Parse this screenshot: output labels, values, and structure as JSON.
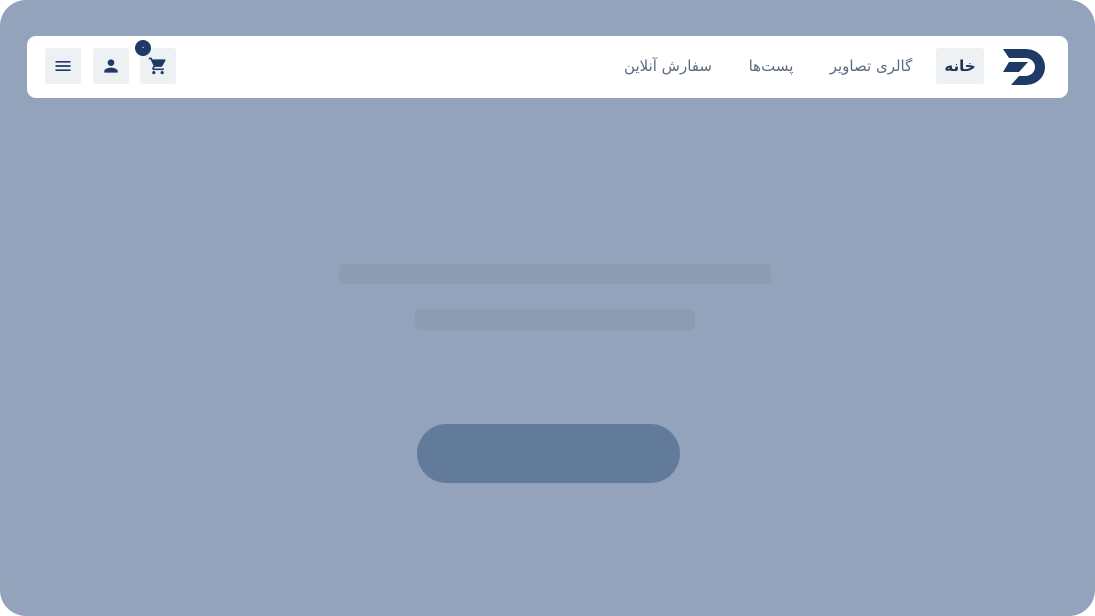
{
  "navbar": {
    "logo_icon": "brand-d-logo-icon",
    "links": [
      {
        "label": "خانه",
        "active": true
      },
      {
        "label": "گالری تصاویر",
        "active": false
      },
      {
        "label": "پست‌ها",
        "active": false
      },
      {
        "label": "سفارش آنلاین",
        "active": false
      }
    ],
    "cart": {
      "icon": "cart-icon",
      "count": "۰"
    },
    "user": {
      "icon": "user-icon"
    },
    "menu": {
      "icon": "menu-icon"
    }
  },
  "colors": {
    "background_overlay": "#92a3bb",
    "brand": "#1f3a66",
    "active_tab_bg": "#eef1f4",
    "skeleton": "#8b9cb3",
    "skeleton_button": "#637b9b"
  }
}
